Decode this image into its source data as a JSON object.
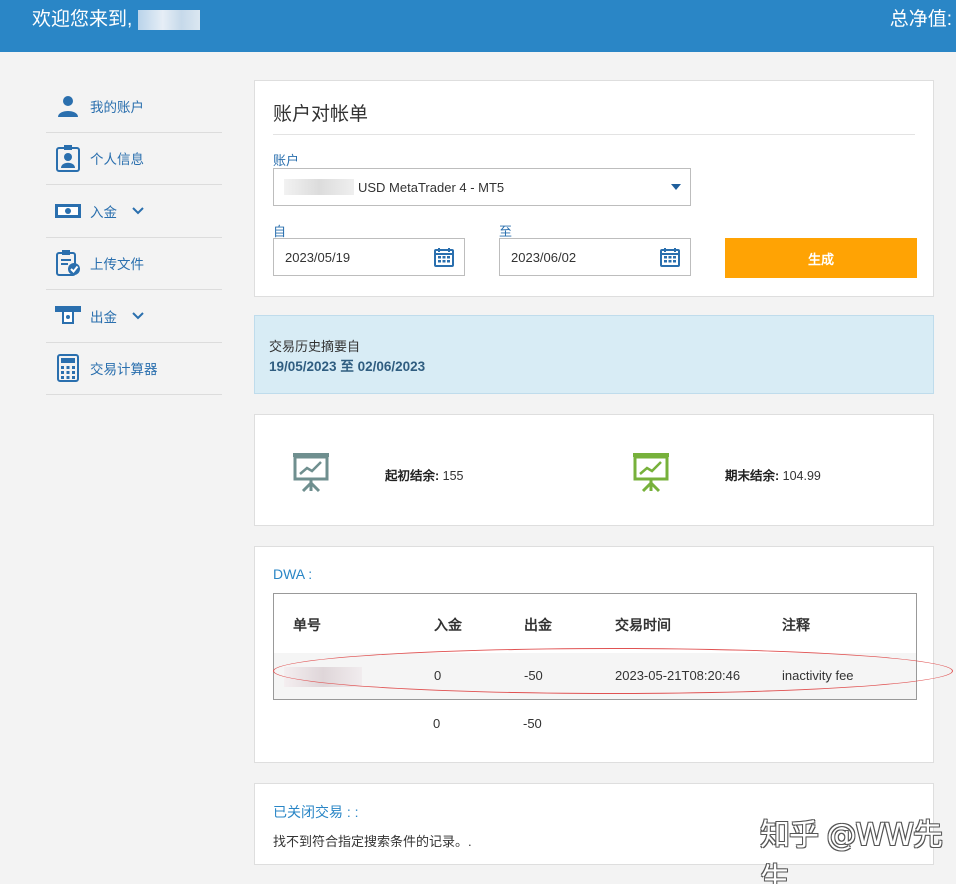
{
  "header": {
    "welcome": "欢迎您来到,",
    "net_worth_label": "总净值:"
  },
  "sidebar": {
    "items": [
      {
        "label": "我的账户",
        "icon": "user-icon"
      },
      {
        "label": "个人信息",
        "icon": "id-badge-icon"
      },
      {
        "label": "入金",
        "icon": "cash-icon",
        "has_submenu": true
      },
      {
        "label": "上传文件",
        "icon": "clipboard-check-icon"
      },
      {
        "label": "出金",
        "icon": "atm-withdraw-icon",
        "has_submenu": true
      },
      {
        "label": "交易计算器",
        "icon": "calculator-icon"
      }
    ]
  },
  "statement": {
    "title": "账户对帐单",
    "account_label": "账户",
    "account_value": "USD MetaTrader 4 - MT5",
    "from_label": "自",
    "from_value": "2023/05/19",
    "to_label": "至",
    "to_value": "2023/06/02",
    "generate_label": "生成"
  },
  "summary": {
    "line1": "交易历史摘要自",
    "line2": "19/05/2023 至 02/06/2023"
  },
  "balances": {
    "opening_label": "起初结余:",
    "opening_value": "155",
    "closing_label": "期末结余:",
    "closing_value": "104.99"
  },
  "dwa": {
    "title": "DWA :",
    "columns": [
      "单号",
      "入金",
      "出金",
      "交易时间",
      "注释"
    ],
    "rows": [
      {
        "deposit": "0",
        "withdraw": "-50",
        "time": "2023-05-21T08:20:46",
        "note": "inactivity fee"
      }
    ],
    "totals": {
      "deposit": "0",
      "withdraw": "-50"
    }
  },
  "closed_trades": {
    "title": "已关闭交易 : :",
    "empty_text": "找不到符合指定搜索条件的记录。."
  },
  "watermark": "知乎 @WW先生",
  "colors": {
    "header": "#2a86c6",
    "accent": "#ffa304",
    "link": "#2a6fae"
  }
}
